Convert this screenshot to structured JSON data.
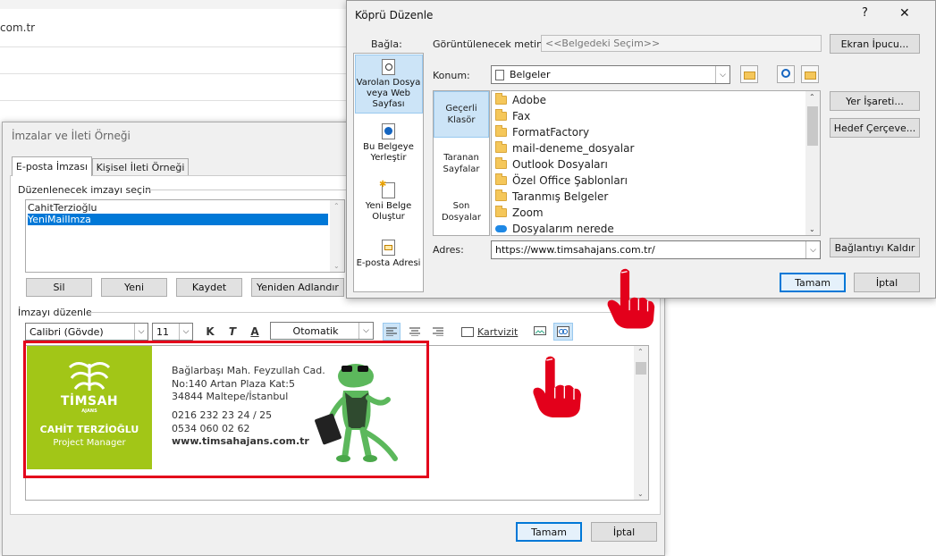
{
  "background": {
    "partial_text": "com.tr"
  },
  "signatures_dialog": {
    "title": "İmzalar ve İleti Örneği",
    "tabs": [
      "E-posta İmzası",
      "Kişisel İleti Örneği"
    ],
    "select_label": "Düzenlenecek imzayı seçin",
    "signatures": [
      "CahitTerzioğlu",
      "YeniMailImza"
    ],
    "selected_index": 1,
    "buttons": {
      "delete": "Sil",
      "new": "Yeni",
      "save": "Kaydet",
      "rename": "Yeniden Adlandır"
    },
    "edit_label": "İmzayı düzenle",
    "toolbar": {
      "font": "Calibri (Gövde)",
      "size": "11",
      "bold": "K",
      "italic": "T",
      "underline": "A",
      "color": "Otomatik",
      "business_card": "Kartvizit"
    },
    "ok": "Tamam",
    "cancel": "İptal"
  },
  "signature_card": {
    "brand": "TİMSAH",
    "brand_sub": "AJANS",
    "name": "CAHİT TERZİOĞLU",
    "role": "Project Manager",
    "address1": "Bağlarbaşı Mah. Feyzullah Cad.",
    "address2": "No:140 Artan Plaza Kat:5",
    "address3": "34844 Maltepe/İstanbul",
    "phone1": "0216 232 23 24 / 25",
    "phone2": "0534 060 02 62",
    "website": "www.timsahajans.com.tr",
    "accent_color": "#a2c617"
  },
  "hyperlink_dialog": {
    "title": "Köprü Düzenle",
    "help": "?",
    "close": "✕",
    "link_to_label": "Bağla:",
    "link_to": [
      "Varolan Dosya veya Web Sayfası",
      "Bu Belgeye Yerleştir",
      "Yeni Belge Oluştur",
      "E-posta Adresi"
    ],
    "display_text_label": "Görüntülenecek metin:",
    "display_text_value": "<<Belgedeki Seçim>>",
    "screentip": "Ekran İpucu...",
    "location_label": "Konum:",
    "location_value": "Belgeler",
    "sections": [
      "Geçerli Klasör",
      "Taranan Sayfalar",
      "Son Dosyalar"
    ],
    "files": [
      "Adobe",
      "Fax",
      "FormatFactory",
      "mail-deneme_dosyalar",
      "Outlook Dosyaları",
      "Özel Office Şablonları",
      "Taranmış Belgeler",
      "Zoom",
      "Dosyalarım nerede"
    ],
    "bookmark": "Yer İşareti...",
    "target_frame": "Hedef Çerçeve...",
    "address_label": "Adres:",
    "address_value": "https://www.timsahajans.com.tr/",
    "remove_link": "Bağlantıyı Kaldır",
    "ok": "Tamam",
    "cancel": "İptal"
  }
}
